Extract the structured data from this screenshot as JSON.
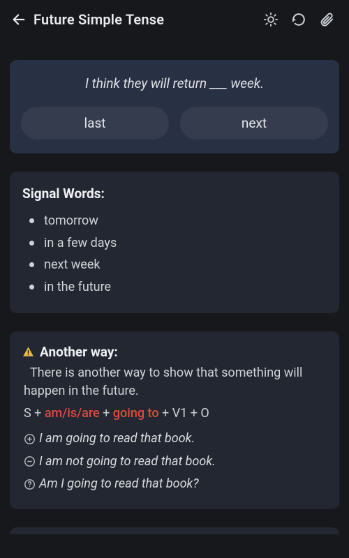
{
  "header": {
    "title": "Future Simple Tense"
  },
  "question": {
    "sentence": "I think they will return ___ week.",
    "options": [
      "last",
      "next"
    ]
  },
  "signal_words": {
    "title": "Signal Words:",
    "items": [
      "tomorrow",
      "in a few days",
      "next week",
      "in the future"
    ]
  },
  "another_way": {
    "title": "Another way:",
    "description_indent": "  ",
    "description": "There is another way to show that something will happen in the future.",
    "formula": {
      "parts": [
        {
          "t": "S",
          "c": "plain"
        },
        {
          "t": " + ",
          "c": "plus"
        },
        {
          "t": "am/is/are",
          "c": "red"
        },
        {
          "t": " + ",
          "c": "plus"
        },
        {
          "t": "going to",
          "c": "red"
        },
        {
          "t": " + ",
          "c": "plus"
        },
        {
          "t": "V1",
          "c": "plain"
        },
        {
          "t": " + ",
          "c": "plus"
        },
        {
          "t": "O",
          "c": "plain"
        }
      ]
    },
    "examples": [
      {
        "icon": "plus",
        "text": "I am going to read that book."
      },
      {
        "icon": "minus",
        "text": "I am not going to read that book."
      },
      {
        "icon": "question",
        "text": "Am I going to read that book?"
      }
    ]
  }
}
